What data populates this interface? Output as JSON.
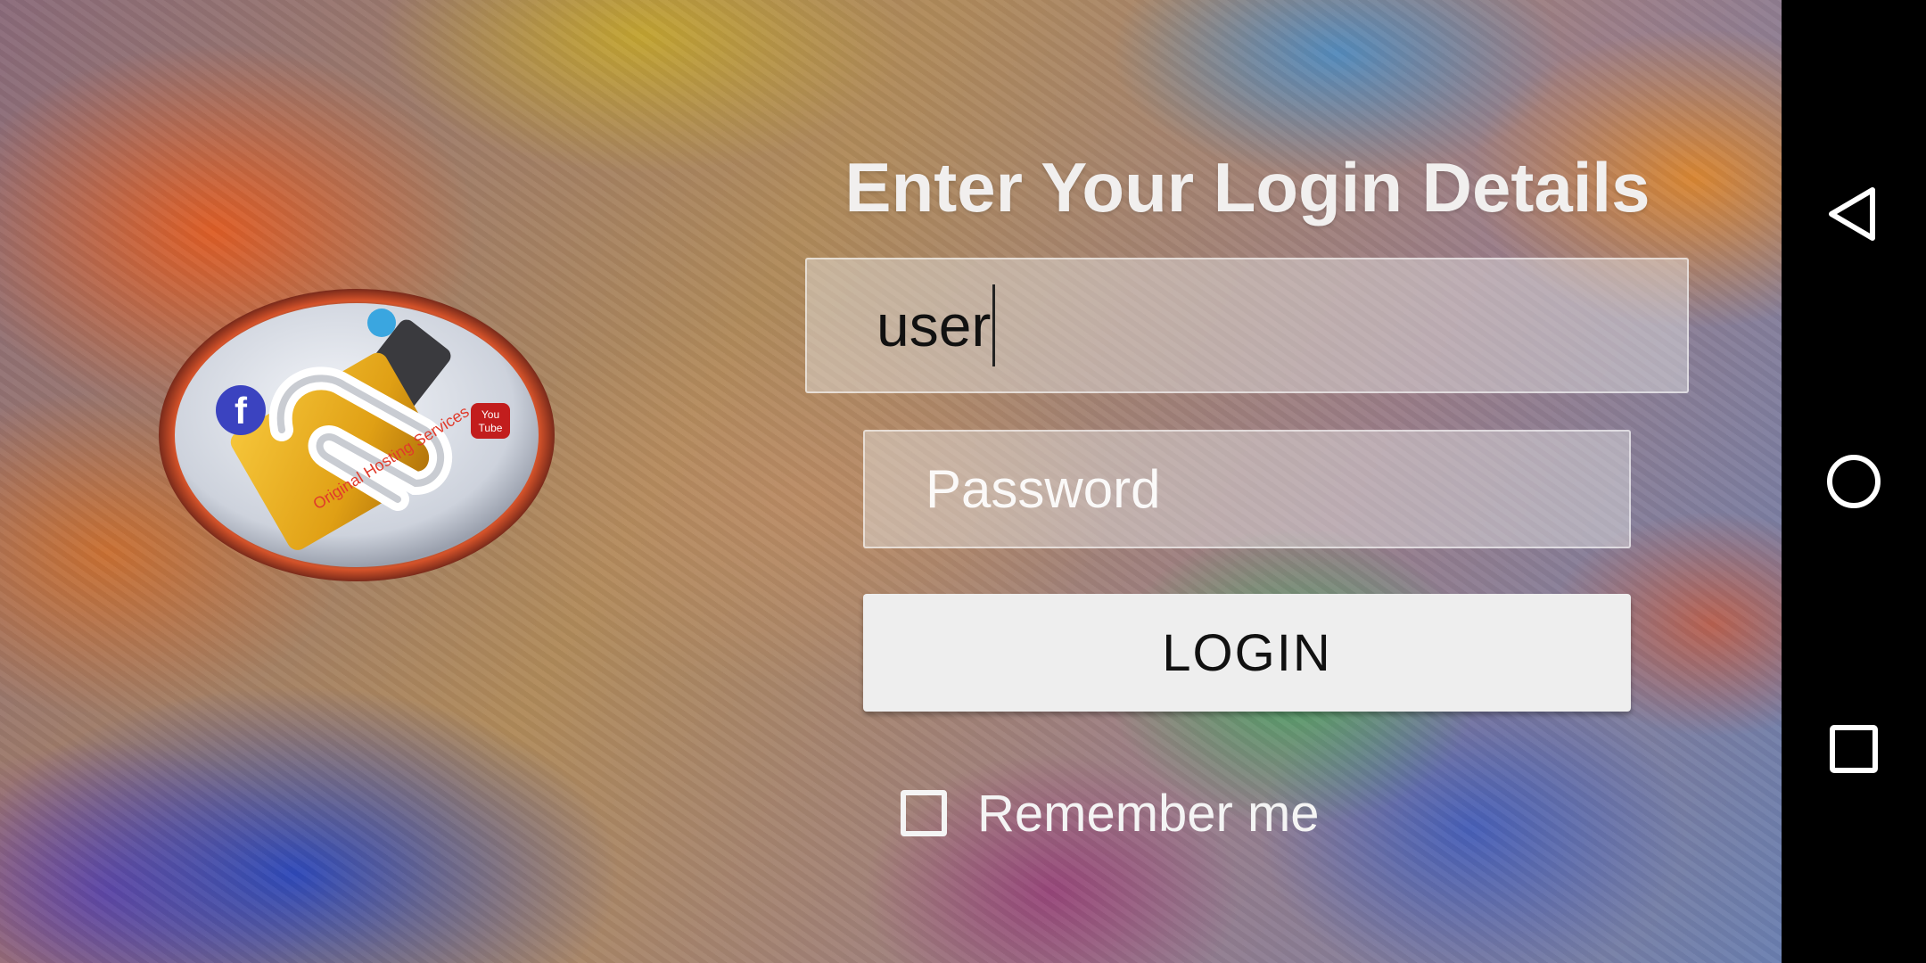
{
  "login_form": {
    "heading": "Enter Your Login Details",
    "username_value": "user",
    "password_placeholder": "Password",
    "login_button_label": "LOGIN",
    "remember_me_label": "Remember me",
    "remember_me_checked": false
  },
  "logo": {
    "text": "Original Hosting Services",
    "badges": [
      "f",
      "You Tube"
    ]
  },
  "nav_bar": {
    "buttons": [
      "back-icon",
      "home-icon",
      "recents-icon"
    ]
  },
  "colors": {
    "heading_text": "#f1efee",
    "button_background": "#eeeeee",
    "nav_bar_background": "#000000"
  }
}
